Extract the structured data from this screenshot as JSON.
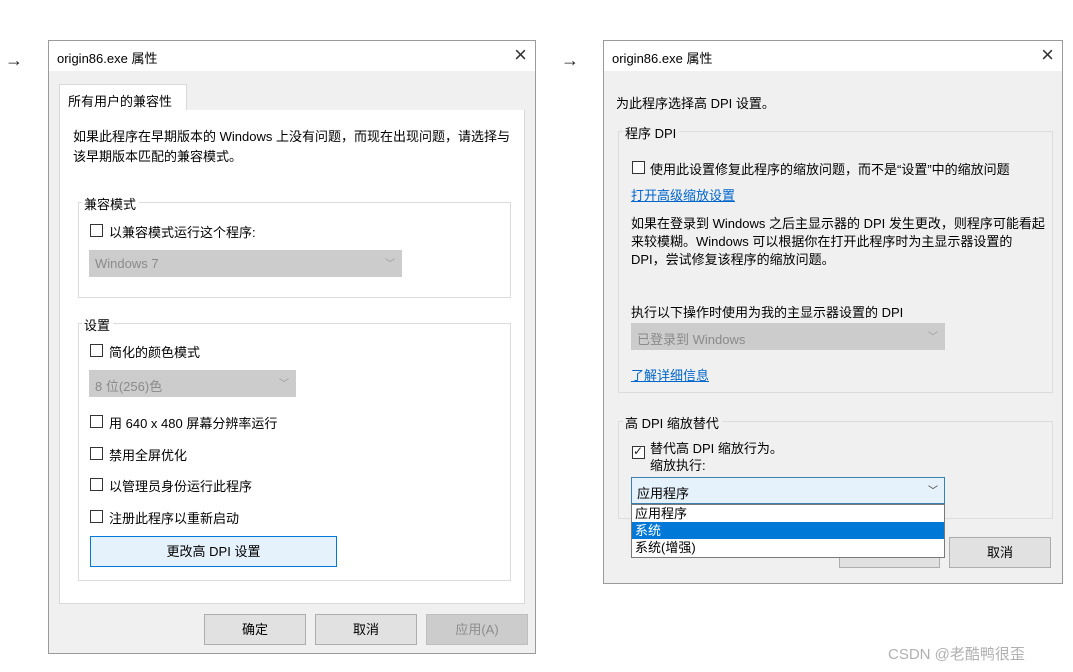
{
  "arrows": [
    "→",
    "→"
  ],
  "left_dialog": {
    "title": "origin86.exe 属性",
    "close": "×",
    "tab": "所有用户的兼容性",
    "intro": "如果此程序在早期版本的 Windows 上没有问题，而现在出现问题，请选择与该早期版本匹配的兼容模式。",
    "compat_group": {
      "legend": "兼容模式",
      "checkbox": "以兼容模式运行这个程序:",
      "checked": false,
      "select_value": "Windows 7"
    },
    "settings_group": {
      "legend": "设置",
      "reduced_color": "简化的颜色模式",
      "color_select_value": "8 位(256)色",
      "run_640": "用 640 x 480 屏幕分辨率运行",
      "disable_fullscreen": "禁用全屏优化",
      "run_admin": "以管理员身份运行此程序",
      "register_restart": "注册此程序以重新启动",
      "dpi_button": "更改高 DPI 设置"
    },
    "buttons": {
      "ok": "确定",
      "cancel": "取消",
      "apply": "应用(A)"
    }
  },
  "right_dialog": {
    "title": "origin86.exe 属性",
    "close": "×",
    "heading": "为此程序选择高 DPI 设置。",
    "program_dpi": {
      "legend": "程序 DPI",
      "checkbox": "使用此设置修复此程序的缩放问题，而不是“设置”中的缩放问题",
      "checked": false,
      "advanced_link": "打开高级缩放设置",
      "description": "如果在登录到 Windows 之后主显示器的 DPI 发生更改，则程序可能看起来较模糊。Windows 可以根据你在打开此程序时为主显示器设置的 DPI，尝试修复该程序的缩放问题。",
      "use_dpi_label": "执行以下操作时使用为我的主显示器设置的 DPI",
      "dpi_select_value": "已登录到 Windows",
      "learn_more": "了解详细信息"
    },
    "override": {
      "legend": "高 DPI 缩放替代",
      "checkbox_line1": "替代高 DPI 缩放行为。",
      "checkbox_line2": "缩放执行:",
      "checked": true,
      "select_value": "应用程序",
      "options": [
        "应用程序",
        "系统",
        "系统(增强)"
      ],
      "selected_option": "系统"
    },
    "buttons": {
      "cancel": "取消"
    }
  },
  "watermark": "CSDN @老酷鸭很歪"
}
